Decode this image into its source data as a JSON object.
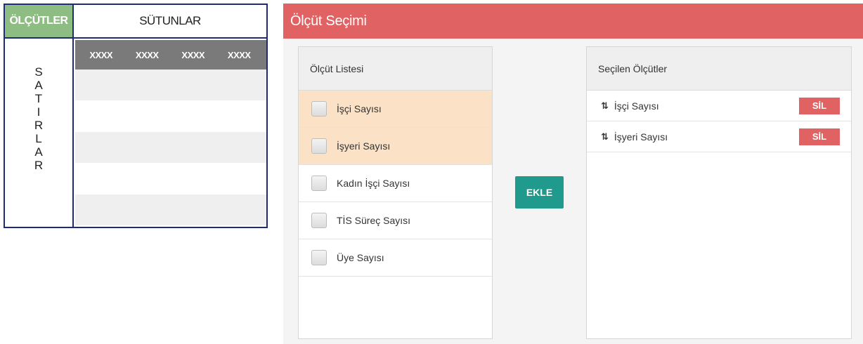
{
  "grid": {
    "header_olcutler": "ÖLÇÜTLER",
    "header_sutunlar": "SÜTUNLAR",
    "satirlar_letters": [
      "S",
      "A",
      "T",
      "I",
      "R",
      "L",
      "A",
      "R"
    ],
    "column_placeholders": [
      "XXXX",
      "XXXX",
      "XXXX",
      "XXXX"
    ]
  },
  "panel": {
    "title": "Ölçüt Seçimi",
    "list_header": "Ölçüt Listesi",
    "selected_header": "Seçilen Ölçütler",
    "add_button": "EKLE",
    "criteria": [
      {
        "label": "İşçi Sayısı",
        "selected": true
      },
      {
        "label": "İşyeri Sayısı",
        "selected": true
      },
      {
        "label": "Kadın İşçi Sayısı",
        "selected": false
      },
      {
        "label": "TİS Süreç Sayısı",
        "selected": false
      },
      {
        "label": "Üye Sayısı",
        "selected": false
      }
    ],
    "selected_criteria": [
      {
        "label": "İşçi Sayısı",
        "sort_icon": "⇅",
        "remove_label": "SİL"
      },
      {
        "label": "İşyeri Sayısı",
        "sort_icon": "⇅",
        "remove_label": "SİL"
      }
    ]
  },
  "colors": {
    "accent_red": "#e06262",
    "teal": "#1f9a8c",
    "green": "#8dbd83",
    "navy_border": "#1f2a78",
    "selected_row": "#fbe2c6"
  }
}
